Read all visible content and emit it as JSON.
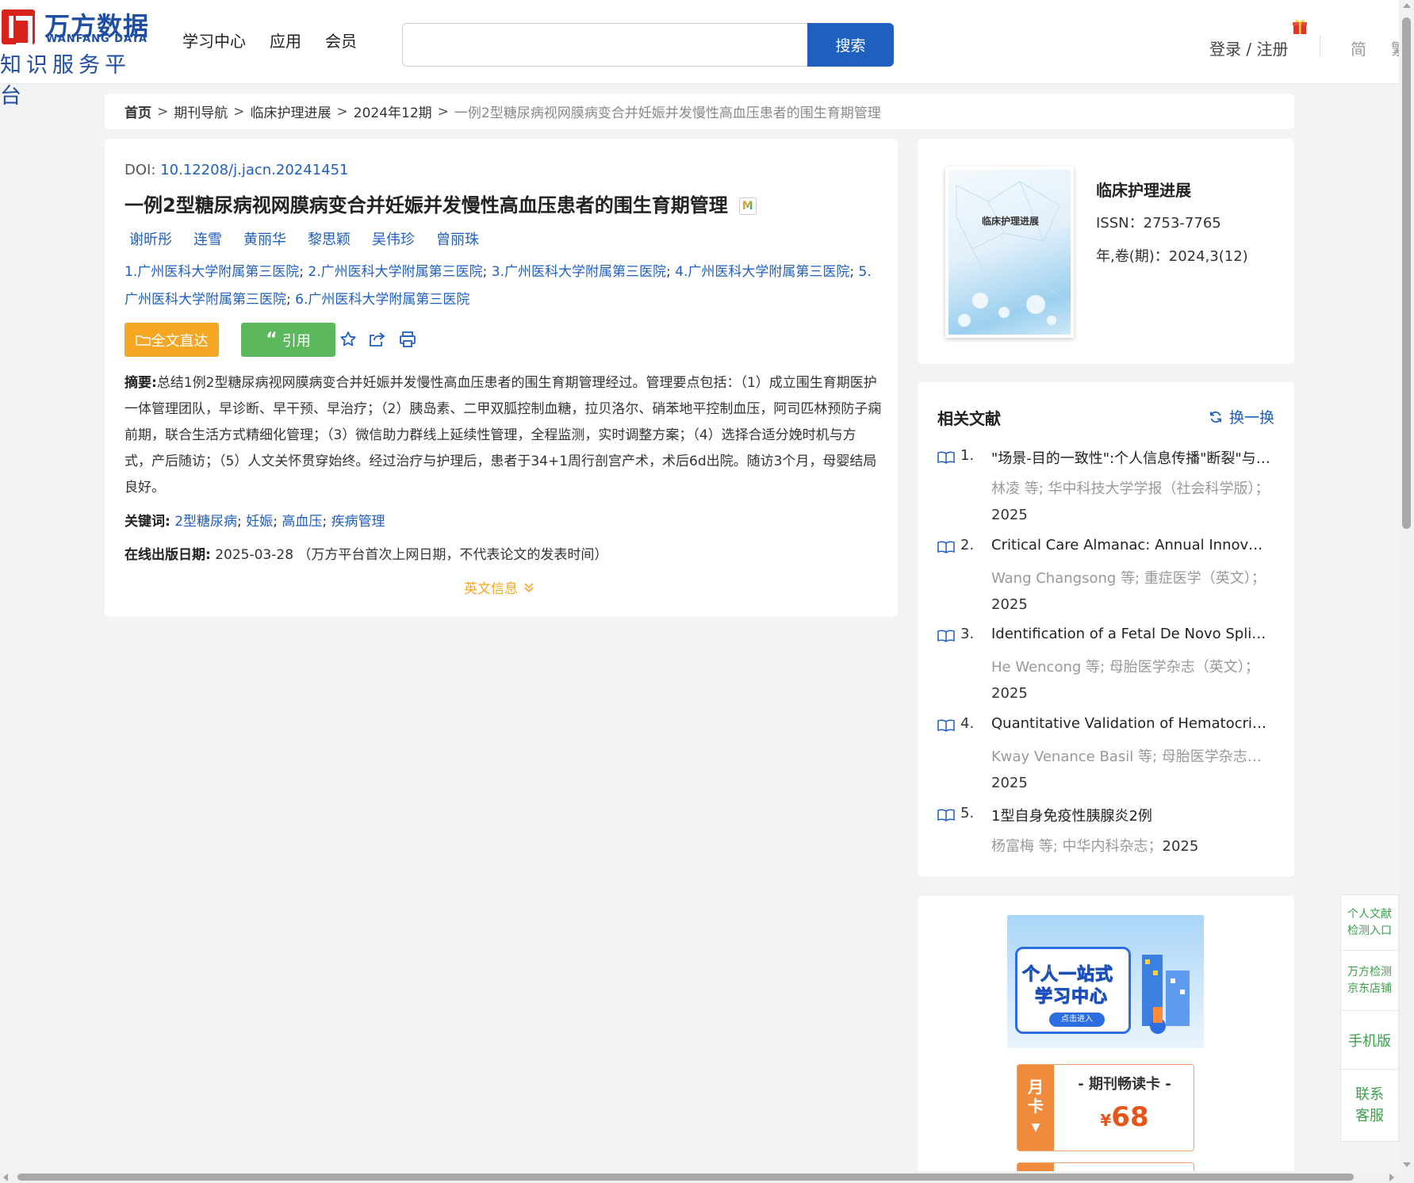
{
  "header": {
    "logo": {
      "cn": "万方数据",
      "en": "WANFANG DATA",
      "sub": "知识服务平台"
    },
    "nav": [
      "学习中心",
      "应用",
      "会员"
    ],
    "search": {
      "value": "",
      "placeholder": "",
      "button": "搜索"
    },
    "login": "登录 / 注册",
    "lang_simplified": "简",
    "lang_traditional": "繁",
    "gift_icon": "gift-icon"
  },
  "breadcrumb": {
    "home": "首页",
    "items": [
      "期刊导航",
      "临床护理进展",
      "2024年12期"
    ],
    "current": "一例2型糖尿病视网膜病变合并妊娠并发慢性高血压患者的围生育期管理",
    "separator": ">"
  },
  "article": {
    "doi_label": "DOI:",
    "doi": "10.12208/j.jacn.20241451",
    "title": "一例2型糖尿病视网膜病变合并妊娠并发慢性高血压患者的围生育期管理",
    "badge": "M",
    "authors": [
      "谢昕彤",
      "连雪",
      "黄丽华",
      "黎思颖",
      "吴伟珍",
      "曾丽珠"
    ],
    "affiliations": [
      "1.广州医科大学附属第三医院",
      "2.广州医科大学附属第三医院",
      "3.广州医科大学附属第三医院",
      "4.广州医科大学附属第三医院",
      "5.广州医科大学附属第三医院",
      "6.广州医科大学附属第三医院"
    ],
    "buttons": {
      "fulltext": "全文直达",
      "cite": "引用"
    },
    "icons": [
      "star-icon",
      "share-icon",
      "print-icon"
    ],
    "abstract_label": "摘要:",
    "abstract": "总结1例2型糖尿病视网膜病变合并妊娠并发慢性高血压患者的围生育期管理经过。管理要点包括：（1）成立围生育期医护一体管理团队，早诊断、早干预、早治疗；（2）胰岛素、二甲双胍控制血糖，拉贝洛尔、硝苯地平控制血压，阿司匹林预防子痫前期，联合生活方式精细化管理；（3）微信助力群线上延续性管理，全程监测，实时调整方案；（4）选择合适分娩时机与方式，产后随访；（5）人文关怀贯穿始终。经过治疗与护理后，患者于34+1周行剖宫产术，术后6d出院。随访3个月，母婴结局良好。",
    "keywords_label": "关键词:",
    "keywords": [
      "2型糖尿病",
      "妊娠",
      "高血压",
      "疾病管理"
    ],
    "pubdate_label": "在线出版日期:",
    "pubdate": "2025-03-28",
    "pubdate_note": "（万方平台首次上网日期，不代表论文的发表时间）",
    "en_info": "英文信息"
  },
  "journal": {
    "cover_title": "临床护理进展",
    "name": "临床护理进展",
    "issn": "ISSN：2753-7765",
    "volume": "年,卷(期)：2024,3(12)"
  },
  "related": {
    "title": "相关文献",
    "refresh": "换一换",
    "items": [
      {
        "num": "1.",
        "title": "\"场景-目的一致性\":个人信息传播\"断裂\"与\"接续\"的逻辑",
        "meta": "林凌  等;  华中科技大学学报（社会科学版）；",
        "year": "2025"
      },
      {
        "num": "2.",
        "title": "Critical Care Almanac: Annual Innovation Report",
        "meta": "Wang Changsong  等;  重症医学（英文）；",
        "year": "2025"
      },
      {
        "num": "3.",
        "title": "Identification of a Fetal De Novo Splice Variant",
        "meta": "He Wencong  等;  母胎医学杂志（英文）；",
        "year": "2025"
      },
      {
        "num": "4.",
        "title": "Quantitative Validation of Hematocrit Pediatric",
        "meta": "Kway Venance Basil  等;  母胎医学杂志（英文）；",
        "year": "2025"
      },
      {
        "num": "5.",
        "title": "1型自身免疫性胰腺炎2例",
        "meta": "杨富梅  等;  中华内科杂志；",
        "year": "2025"
      }
    ]
  },
  "promo": {
    "banner_line1": "个人一站式",
    "banner_line2": "学习中心",
    "banner_enter": "点击进入",
    "card_side": "月卡",
    "card_title": "- 期刊畅读卡 -",
    "card_currency": "¥",
    "card_price": "68"
  },
  "float_side": {
    "item1": "个人文献检测入口",
    "item2": "万方检测京东店铺",
    "item3": "手机版",
    "item4": "联系客服"
  },
  "colors": {
    "brand_blue": "#1f5fc0",
    "logo_red": "#d7231b",
    "fulltext_orange": "#f5a623",
    "cite_green": "#5cb85c",
    "side_green": "#3aa14a"
  }
}
